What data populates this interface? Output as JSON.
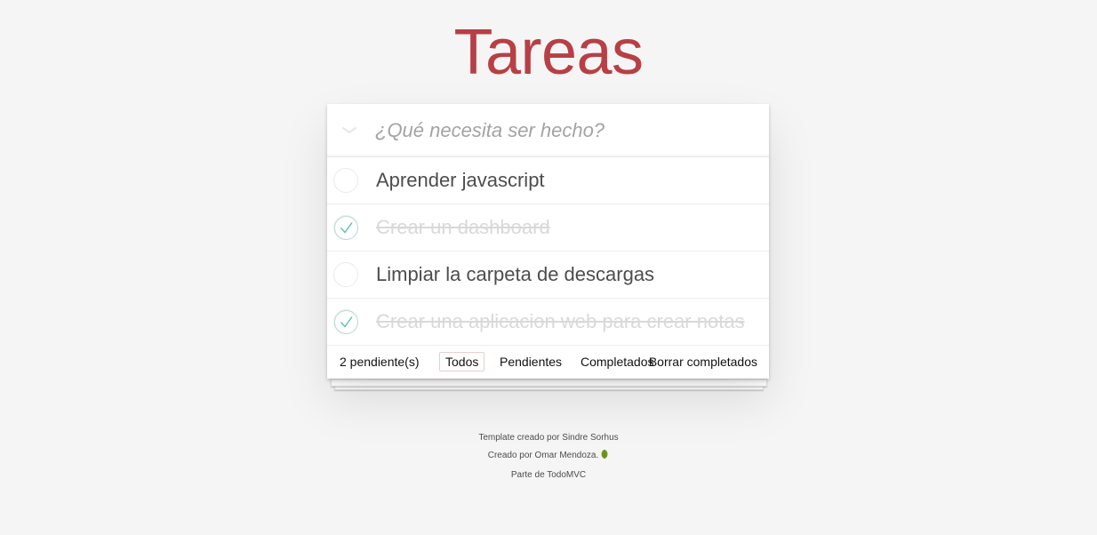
{
  "app": {
    "title": "Tareas",
    "accent_color": "#b83f45",
    "background_color": "#f5f5f5"
  },
  "new_todo": {
    "placeholder": "¿Qué necesita ser hecho?",
    "value": ""
  },
  "todos": [
    {
      "label": "Aprender javascript",
      "completed": false
    },
    {
      "label": "Crear un dashboard",
      "completed": true
    },
    {
      "label": "Limpiar la carpeta de descargas",
      "completed": false
    },
    {
      "label": "Crear una aplicacion web para crear notas",
      "completed": true
    }
  ],
  "footer": {
    "count_text": "2 pendiente(s)",
    "filters": [
      {
        "label": "Todos",
        "selected": true
      },
      {
        "label": "Pendientes",
        "selected": false
      },
      {
        "label": "Completados",
        "selected": false
      }
    ],
    "clear_label": "Borrar completados"
  },
  "info": {
    "line1": "Template creado por Sindre Sorhus",
    "line2": "Creado por Omar Mendoza.",
    "line3": "Parte de TodoMVC",
    "line2_icon": "cactus-icon"
  }
}
